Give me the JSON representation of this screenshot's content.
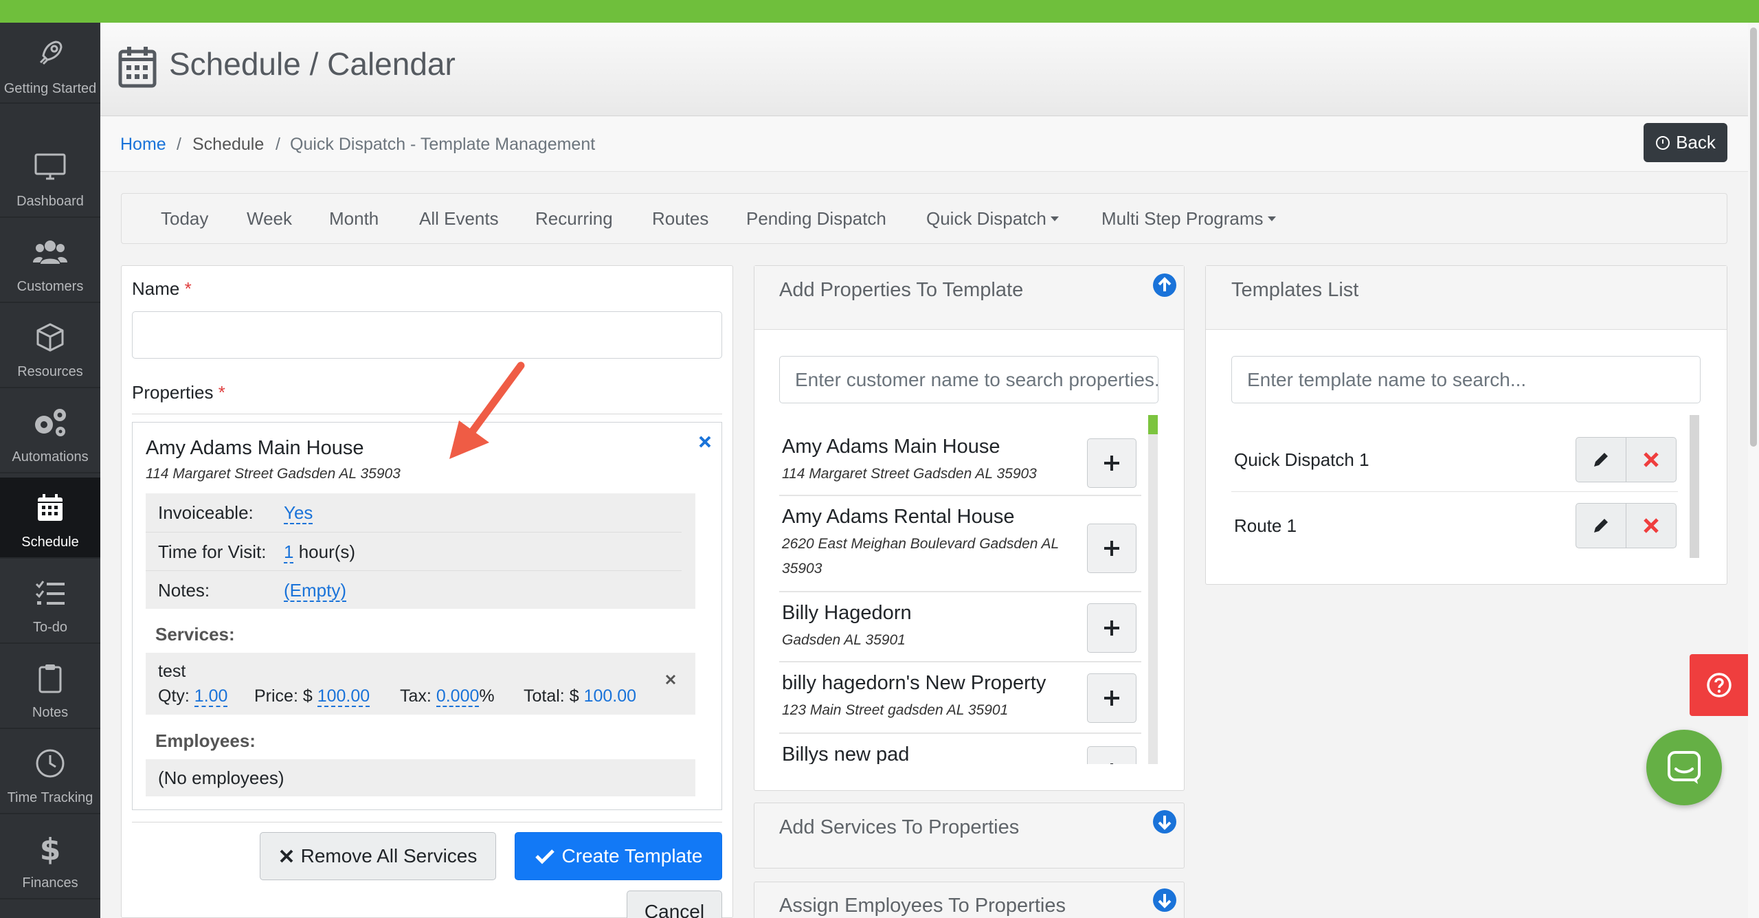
{
  "sidebar": {
    "items": [
      {
        "label": "Getting Started",
        "icon": "rocket-icon"
      },
      {
        "label": "Dashboard",
        "icon": "monitor-icon"
      },
      {
        "label": "Customers",
        "icon": "users-icon"
      },
      {
        "label": "Resources",
        "icon": "box-icon"
      },
      {
        "label": "Automations",
        "icon": "gears-icon"
      },
      {
        "label": "Schedule",
        "icon": "calendar-icon"
      },
      {
        "label": "To-do",
        "icon": "checklist-icon"
      },
      {
        "label": "Notes",
        "icon": "clipboard-icon"
      },
      {
        "label": "Time Tracking",
        "icon": "clock-icon"
      },
      {
        "label": "Finances",
        "icon": "dollar-icon"
      }
    ],
    "active": "Schedule"
  },
  "header": {
    "title": "Schedule / Calendar"
  },
  "breadcrumb": {
    "home": "Home",
    "sep1": "/",
    "schedule": "Schedule",
    "sep2": "/",
    "current": "Quick Dispatch - Template Management",
    "back_label": "Back"
  },
  "nav": {
    "today": "Today",
    "week": "Week",
    "month": "Month",
    "all_events": "All Events",
    "recurring": "Recurring",
    "routes": "Routes",
    "pending_dispatch": "Pending Dispatch",
    "quick_dispatch": "Quick Dispatch",
    "multi_step": "Multi Step Programs"
  },
  "form": {
    "name_label": "Name",
    "required_mark": "*",
    "name_value": "",
    "properties_label": "Properties",
    "property": {
      "name": "Amy Adams Main House",
      "address": "114 Margaret Street Gadsden AL 35903",
      "invoiceable_label": "Invoiceable:",
      "invoiceable_value": "Yes",
      "time_label": "Time for Visit:",
      "time_value": "1",
      "time_unit": "hour(s)",
      "notes_label": "Notes:",
      "notes_value": "(Empty)",
      "services_label": "Services:",
      "service": {
        "name": "test",
        "qty_label": "Qty:",
        "qty": "1.00",
        "price_label": "Price: $",
        "price": "100.00",
        "tax_label": "Tax:",
        "tax": "0.000",
        "tax_unit": "%",
        "total_label": "Total: $",
        "total": "100.00"
      },
      "employees_label": "Employees:",
      "employees_value": "(No employees)"
    },
    "remove_all_label": "Remove All Services",
    "create_label": "Create Template",
    "cancel_label": "Cancel"
  },
  "add_properties": {
    "title": "Add Properties To Template",
    "search_placeholder": "Enter customer name to search properties...",
    "items": [
      {
        "name": "Amy Adams Main House",
        "address": "114 Margaret Street Gadsden AL 35903"
      },
      {
        "name": "Amy Adams Rental House",
        "address_line1": "2620 East Meighan Boulevard Gadsden AL",
        "address_line2": "35903"
      },
      {
        "name": "Billy Hagedorn",
        "address": "Gadsden AL 35901"
      },
      {
        "name": "billy hagedorn's New Property",
        "address": "123 Main Street gadsden AL 35901"
      },
      {
        "name": "Billys new pad",
        "address": ""
      }
    ]
  },
  "add_services": {
    "title": "Add Services To Properties"
  },
  "assign_employees": {
    "title": "Assign Employees To Properties"
  },
  "templates": {
    "title": "Templates List",
    "search_placeholder": "Enter template name to search...",
    "items": [
      {
        "name": "Quick Dispatch 1"
      },
      {
        "name": "Route 1"
      }
    ]
  },
  "colors": {
    "top_bar": "#6fbf3c",
    "sidebar_bg": "#2f3236",
    "primary": "#1279f6",
    "link": "#1a73d9",
    "danger": "#ef3e3e",
    "arrow": "#ef5c45",
    "chat": "#65b045"
  }
}
